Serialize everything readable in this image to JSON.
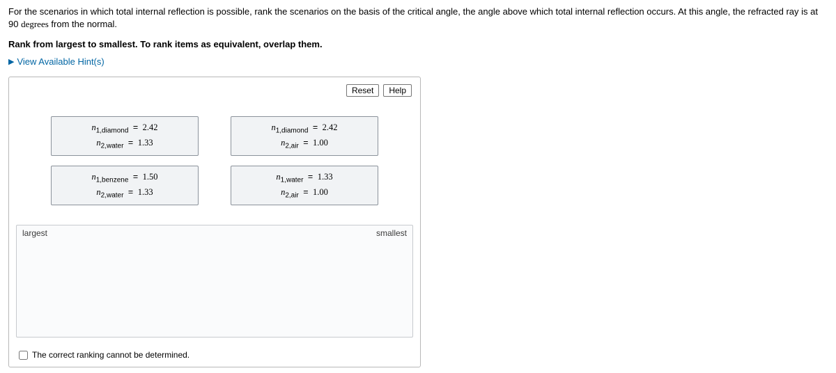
{
  "question": {
    "line1_pre": "For the scenarios in which total internal reflection is possible, rank the scenarios on the basis of the critical angle, the angle above which total internal reflection occurs. At this angle, the refracted ray is at 90 ",
    "degrees_word": "degrees",
    "line1_post": " from the normal.",
    "instruction": "Rank from largest to smallest. To rank items as equivalent, overlap them.",
    "hint_label": "View Available Hint(s)"
  },
  "buttons": {
    "reset": "Reset",
    "help": "Help"
  },
  "items": [
    {
      "n1_sub": "1,diamond",
      "n1_val": "2.42",
      "n2_sub": "2,water",
      "n2_val": "1.33"
    },
    {
      "n1_sub": "1,diamond",
      "n1_val": "2.42",
      "n2_sub": "2,air",
      "n2_val": "1.00"
    },
    {
      "n1_sub": "1,benzene",
      "n1_val": "1.50",
      "n2_sub": "2,water",
      "n2_val": "1.33"
    },
    {
      "n1_sub": "1,water",
      "n1_val": "1.33",
      "n2_sub": "2,air",
      "n2_val": "1.00"
    }
  ],
  "dropzone": {
    "left": "largest",
    "right": "smallest"
  },
  "checkbox_label": "The correct ranking cannot be determined."
}
